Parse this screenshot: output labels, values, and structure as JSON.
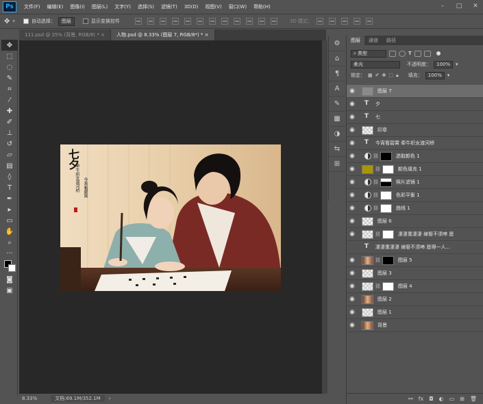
{
  "menubar": {
    "logo": "Ps",
    "items": [
      "文件(F)",
      "编辑(E)",
      "图像(I)",
      "图层(L)",
      "文字(Y)",
      "选择(S)",
      "滤镜(T)",
      "3D(D)",
      "视图(V)",
      "窗口(W)",
      "帮助(H)"
    ]
  },
  "options": {
    "auto_select_label": "自动选择：",
    "auto_select_value": "图层",
    "show_transform_label": "显示变换控件",
    "mode3d_label": "3D 模式："
  },
  "tabs": [
    {
      "label": "111.psd @ 25% (背景, RGB/8) *"
    },
    {
      "label": "人物.psd @ 8.33% (图层 7, RGB/8*) *"
    }
  ],
  "status": {
    "zoom": "8.33%",
    "doc": "文档:69.1M/352.1M"
  },
  "poster": {
    "title": "七夕",
    "subtitle_line1": "牵牛织女渡河桥",
    "subtitle_line2": "今宵看碧霄"
  },
  "panel": {
    "tabs": [
      "图层",
      "通道",
      "路径"
    ],
    "filter_kind": "类型",
    "blend_mode": "柔光",
    "opacity_label": "不透明度：",
    "opacity_value": "100%",
    "lock_label": "锁定：",
    "fill_label": "填充：",
    "fill_value": "100%"
  },
  "layers": [
    {
      "name": "图层 7",
      "thumb": "gray",
      "mask": "",
      "selected": true,
      "visible": true
    },
    {
      "name": "夕",
      "thumb": "text",
      "mask": "",
      "selected": false,
      "visible": true
    },
    {
      "name": "七",
      "thumb": "text",
      "mask": "",
      "selected": false,
      "visible": true
    },
    {
      "name": "印章",
      "thumb": "checker",
      "mask": "",
      "selected": false,
      "visible": true
    },
    {
      "name": "今宵看碧霄 牵牛织女渡河桥",
      "thumb": "text",
      "mask": "",
      "selected": false,
      "visible": true
    },
    {
      "name": "选取颜色 1",
      "thumb": "adjust",
      "mask": "black",
      "selected": false,
      "visible": true
    },
    {
      "name": "颜色填充 1",
      "thumb": "yellow",
      "mask": "white",
      "selected": false,
      "visible": true
    },
    {
      "name": "照片滤镜 1",
      "thumb": "adjust",
      "mask": "blackwhite",
      "selected": false,
      "visible": true
    },
    {
      "name": "色彩平衡 1",
      "thumb": "adjust",
      "mask": "white",
      "selected": false,
      "visible": true
    },
    {
      "name": "曲线 1",
      "thumb": "adjust",
      "mask": "white",
      "selected": false,
      "visible": true
    },
    {
      "name": "图层 6",
      "thumb": "checker",
      "mask": "",
      "selected": false,
      "visible": true
    },
    {
      "name": "凄凄重凄凄 嫁娶不须啼 愿",
      "thumb": "checker",
      "mask": "white",
      "selected": false,
      "visible": true
    },
    {
      "name": "凄凄重凄凄 嫁娶不须啼 愿得一人...",
      "thumb": "text",
      "mask": "",
      "selected": false,
      "visible": false
    },
    {
      "name": "图层 5",
      "thumb": "photo",
      "mask": "black",
      "selected": false,
      "visible": true
    },
    {
      "name": "图层 3",
      "thumb": "checker",
      "mask": "",
      "selected": false,
      "visible": true
    },
    {
      "name": "图层 4",
      "thumb": "checker",
      "mask": "white",
      "selected": false,
      "visible": true
    },
    {
      "name": "图层 2",
      "thumb": "photo",
      "mask": "",
      "selected": false,
      "visible": true
    },
    {
      "name": "图层 1",
      "thumb": "checker",
      "mask": "",
      "selected": false,
      "visible": true
    },
    {
      "name": "背景",
      "thumb": "photo",
      "mask": "",
      "selected": false,
      "visible": true
    }
  ]
}
